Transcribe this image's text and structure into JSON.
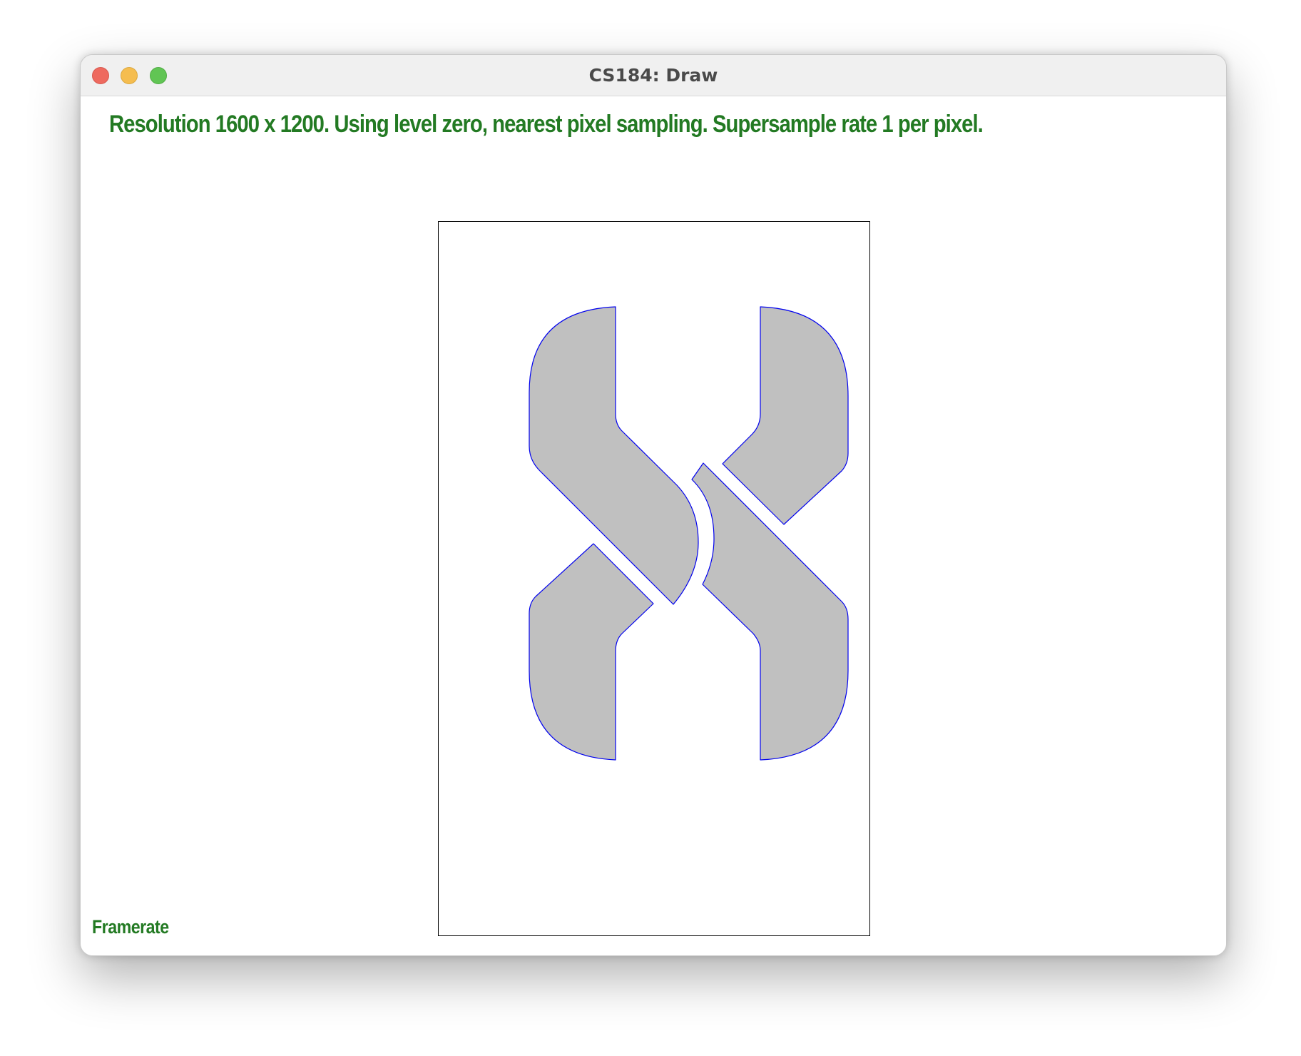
{
  "window": {
    "title": "CS184: Draw"
  },
  "status": {
    "text": "Resolution 1600 x 1200. Using level zero, nearest pixel sampling. Supersample rate 1 per pixel."
  },
  "footer": {
    "framerate_label": "Framerate"
  },
  "colors": {
    "status_text": "#237a23",
    "shape_fill": "#c0c0c0",
    "shape_stroke": "#0000ee",
    "canvas_border": "#000000"
  },
  "icons": {
    "close": "close-icon",
    "minimize": "minimize-icon",
    "zoom": "zoom-icon"
  }
}
